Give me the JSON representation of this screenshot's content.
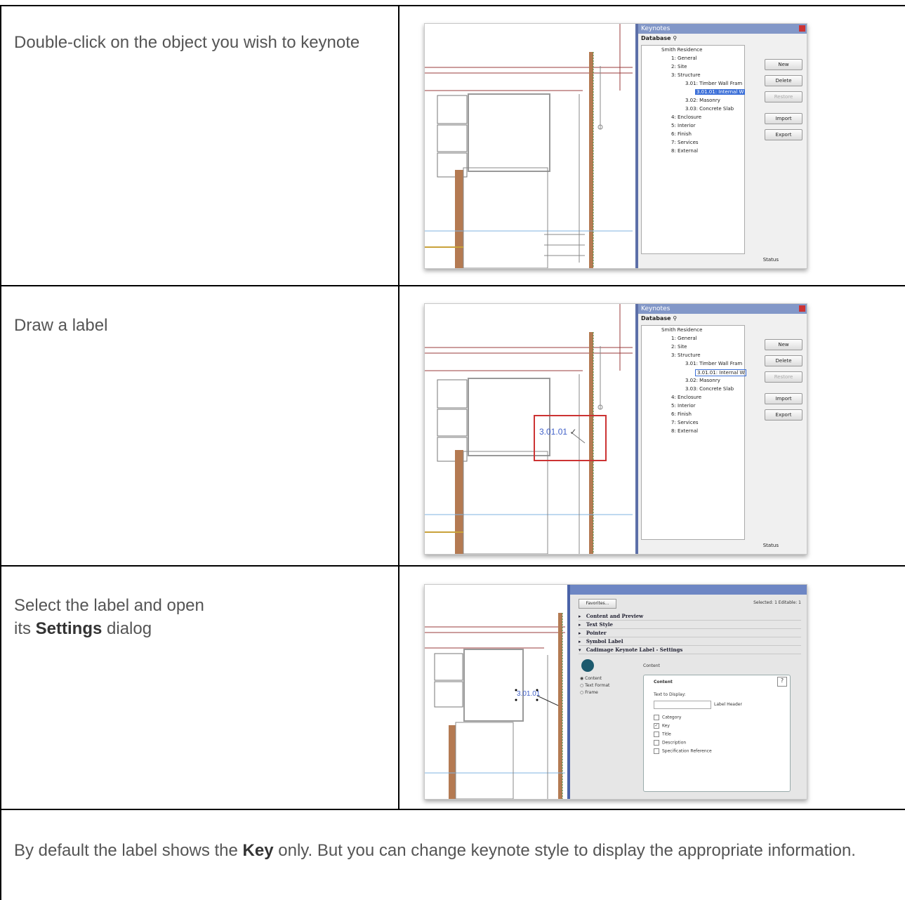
{
  "rows": [
    {
      "instruction": "Double-click on the object you wish to keynote",
      "panel": {
        "title": "Keynotes",
        "database_label": "Database",
        "tree": [
          "Smith Residence",
          "1: General",
          "2: Site",
          "3: Structure",
          "3.01: Timber Wall Fram",
          "3.01.01: Internal W",
          "3.02: Masonry",
          "3.03: Concrete Slab",
          "4: Enclosure",
          "5: Interior",
          "6: Finish",
          "7: Services",
          "8: External"
        ],
        "buttons": [
          "New",
          "Delete",
          "Restore",
          "Import",
          "Export"
        ],
        "status_label": "Status"
      }
    },
    {
      "instruction": "Draw a label",
      "label_key": "3.01.01",
      "panel": {
        "title": "Keynotes",
        "database_label": "Database",
        "tree": [
          "Smith Residence",
          "1: General",
          "2: Site",
          "3: Structure",
          "3.01: Timber Wall Fram",
          "3.01.01: Internal W",
          "3.02: Masonry",
          "3.03: Concrete Slab",
          "4: Enclosure",
          "5: Interior",
          "6: Finish",
          "7: Services",
          "8: External"
        ],
        "buttons": [
          "New",
          "Delete",
          "Restore",
          "Import",
          "Export"
        ],
        "status_label": "Status"
      }
    },
    {
      "instruction_prefix": "Select the label and open",
      "instruction_mid": "its ",
      "instruction_bold": "Settings",
      "instruction_suffix": " dialog",
      "label_key": "3.01.01",
      "dialog": {
        "favorites_label": "Favorites...",
        "selection_info": "Selected: 1 Editable: 1",
        "sections": [
          "Content and Preview",
          "Text Style",
          "Pointer",
          "Symbol Label",
          "Cadimage Keynote Label - Settings"
        ],
        "content_header": "Content",
        "radio_options": [
          "Content",
          "Text Format",
          "Frame"
        ],
        "panel_title": "Content",
        "help": "?",
        "text_to_display": "Text to Display:",
        "label_header": "Label Header",
        "checkboxes": [
          {
            "label": "Category",
            "checked": false
          },
          {
            "label": "Key",
            "checked": true
          },
          {
            "label": "Title",
            "checked": false
          },
          {
            "label": "Description",
            "checked": false
          },
          {
            "label": "Specification Reference",
            "checked": false
          }
        ]
      }
    }
  ],
  "footer": {
    "prefix": "By default the label shows the ",
    "bold": "Key",
    "suffix": " only. But you can change keynote style to display the appropriate information."
  }
}
